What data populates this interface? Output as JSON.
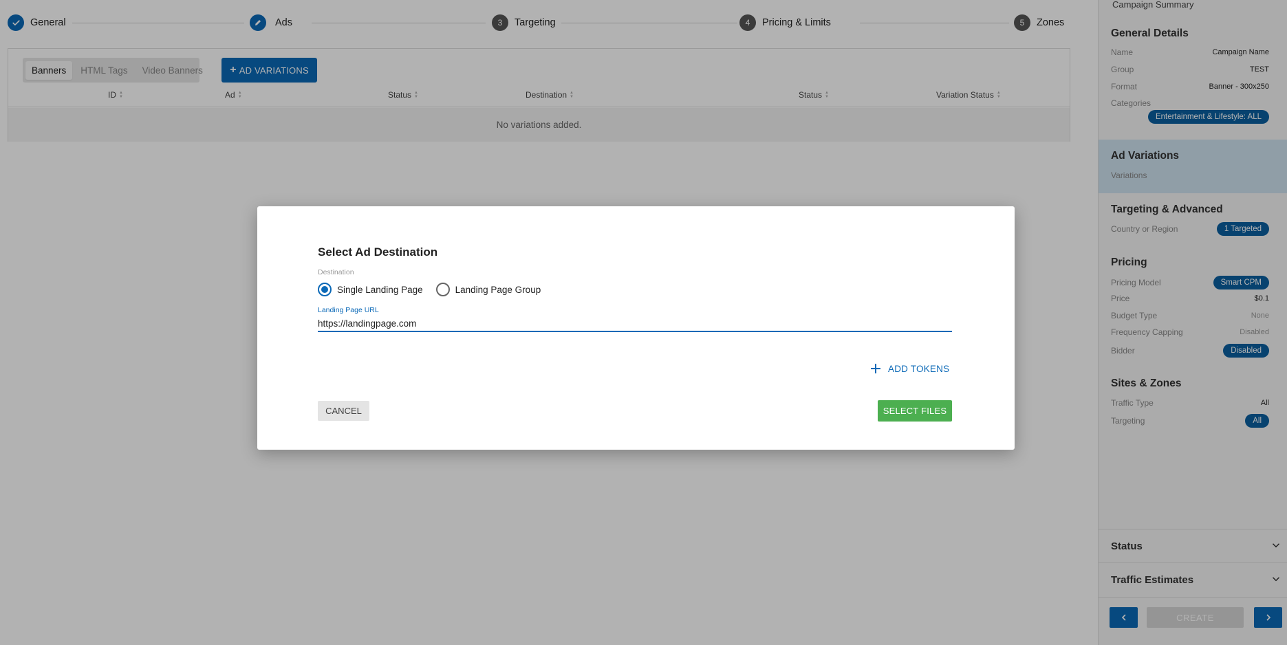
{
  "stepper": {
    "steps": [
      {
        "label": "General",
        "marker": "check-icon",
        "state": "done"
      },
      {
        "label": "Ads",
        "marker": "pencil-icon",
        "state": "current"
      },
      {
        "label": "Targeting",
        "number": "3",
        "state": "todo"
      },
      {
        "label": "Pricing & Limits",
        "number": "4",
        "state": "todo"
      },
      {
        "label": "Zones",
        "number": "5",
        "state": "todo"
      }
    ]
  },
  "ads": {
    "tabs": [
      "Banners",
      "HTML Tags",
      "Video Banners"
    ],
    "active_tab": "Banners",
    "add_button": "AD VARIATIONS",
    "columns": [
      "ID",
      "Ad",
      "Status",
      "Destination",
      "Status",
      "Variation Status"
    ],
    "empty_text": "No variations added."
  },
  "summary": {
    "title": "Campaign Summary",
    "general": {
      "heading": "General Details",
      "name_label": "Name",
      "name_value": "Campaign Name",
      "group_label": "Group",
      "group_value": "TEST",
      "format_label": "Format",
      "format_value": "Banner - 300x250",
      "categories_label": "Categories",
      "categories_value": "Entertainment & Lifestyle: ALL"
    },
    "ad_variations": {
      "heading": "Ad Variations",
      "variations_label": "Variations"
    },
    "targeting": {
      "heading": "Targeting & Advanced",
      "country_label": "Country or Region",
      "country_value": "1 Targeted"
    },
    "pricing": {
      "heading": "Pricing",
      "model_label": "Pricing Model",
      "model_value": "Smart CPM",
      "price_label": "Price",
      "price_value": "$0.1",
      "budget_label": "Budget Type",
      "budget_value": "None",
      "freq_label": "Frequency Capping",
      "freq_value": "Disabled",
      "bidder_label": "Bidder",
      "bidder_value": "Disabled"
    },
    "sites": {
      "heading": "Sites & Zones",
      "traffic_label": "Traffic Type",
      "traffic_value": "All",
      "targeting_label": "Targeting",
      "targeting_value": "All"
    },
    "status_heading": "Status",
    "traffic_estimates_heading": "Traffic Estimates",
    "create_label": "CREATE"
  },
  "dialog": {
    "title": "Select Ad Destination",
    "destination_label": "Destination",
    "options": [
      "Single Landing Page",
      "Landing Page Group"
    ],
    "selected_option": "Single Landing Page",
    "url_label": "Landing Page URL",
    "url_value": "https://landingpage.com",
    "add_tokens": "ADD TOKENS",
    "cancel": "CANCEL",
    "select_files": "SELECT FILES"
  },
  "colors": {
    "primary": "#0b69b7",
    "pill": "#0b5fa0",
    "success": "#4caf50",
    "highlight": "#cfe2f0"
  }
}
